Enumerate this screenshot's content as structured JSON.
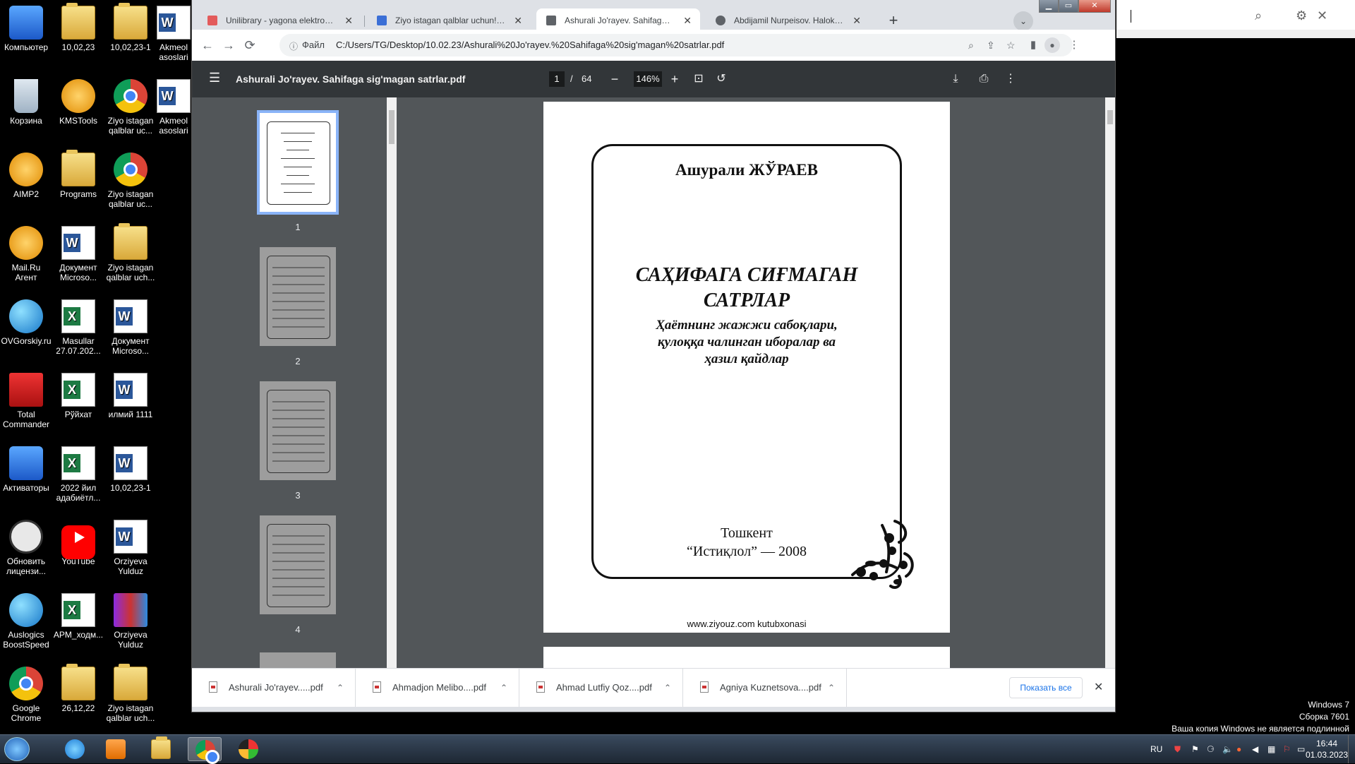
{
  "desktop": {
    "icons": [
      {
        "label": "Компьютер",
        "kind": "blue"
      },
      {
        "label": "10,02,23",
        "kind": "folder"
      },
      {
        "label": "10,02,23-1",
        "kind": "folder"
      },
      {
        "label": "Akmeol asoslari",
        "kind": "word"
      },
      {
        "label": "Корзина",
        "kind": "bin"
      },
      {
        "label": "KMSTools",
        "kind": "orange"
      },
      {
        "label": "Ziyo istagan qalblar uc...",
        "kind": "chrome"
      },
      {
        "label": "Akmeol asoslari",
        "kind": "word"
      },
      {
        "label": "AIMP2",
        "kind": "orange"
      },
      {
        "label": "Programs",
        "kind": "folder"
      },
      {
        "label": "Ziyo istagan qalblar uc...",
        "kind": "chrome"
      },
      {
        "label": "Mail.Ru Агент",
        "kind": "orange"
      },
      {
        "label": "Документ Microso...",
        "kind": "word"
      },
      {
        "label": "Ziyo istagan qalblar uch...",
        "kind": "folder"
      },
      {
        "label": "OVGorskiy.ru",
        "kind": "globe"
      },
      {
        "label": "Masullar 27.07.202...",
        "kind": "excel"
      },
      {
        "label": "Документ Microso...",
        "kind": "word"
      },
      {
        "label": "Total Commander",
        "kind": "disk"
      },
      {
        "label": "Рўйхат",
        "kind": "excel"
      },
      {
        "label": "илмий 1111",
        "kind": "word"
      },
      {
        "label": "Активаторы",
        "kind": "blue"
      },
      {
        "label": "2022 йил адабиётл...",
        "kind": "excel"
      },
      {
        "label": "10,02,23-1",
        "kind": "word"
      },
      {
        "label": "Обновить лицензи...",
        "kind": "skull"
      },
      {
        "label": "YouTube",
        "kind": "yt"
      },
      {
        "label": "Orziyeva Yulduz",
        "kind": "word"
      },
      {
        "label": "Auslogics BoostSpeed",
        "kind": "globe"
      },
      {
        "label": "APM_ходм...",
        "kind": "excel"
      },
      {
        "label": "Orziyeva Yulduz",
        "kind": "rar"
      },
      {
        "label": "Google Chrome",
        "kind": "chrome"
      },
      {
        "label": "26,12,22",
        "kind": "folder"
      },
      {
        "label": "Ziyo istagan qalblar uch...",
        "kind": "folder"
      }
    ]
  },
  "browser": {
    "tabs": [
      {
        "title": "Unilibrary - yagona elektron kutub",
        "favicon_color": "#e35b5b",
        "active": false
      },
      {
        "title": "Ziyo istagan qalblar uchun! - Kutub",
        "favicon_color": "#3b6fd6",
        "active": false
      },
      {
        "title": "Ashurali Jo'rayev. Sahifaga sig'mag",
        "favicon_color": "#5f6368",
        "active": true
      },
      {
        "title": "Abdijamil Nurpeisov. Halokat (trilo",
        "favicon_color": "#5f6368",
        "active": false
      }
    ],
    "new_tab_symbol": "+",
    "tab_search_symbol": "⌄",
    "address": {
      "scheme_label": "Файл",
      "url": "C:/Users/TG/Desktop/10.02.23/Ashurali%20Jo'rayev.%20Sahifaga%20sig'magan%20satrlar.pdf"
    }
  },
  "pdf": {
    "title": "Ashurali Jo'rayev. Sahifaga sig'magan satrlar.pdf",
    "current_page": "1",
    "page_separator": "/",
    "total_pages": "64",
    "zoom": "146%",
    "thumbnails": [
      "1",
      "2",
      "3",
      "4"
    ],
    "page1": {
      "author": "Ашурали ЖЎРАЕВ",
      "title_line1": "САҲИФАГА  СИҒМАГАН",
      "title_line2": "САТРЛАР",
      "subtitle_line1": "Ҳаётнинг жажжи сабоқлари,",
      "subtitle_line2": "қулоққа чалинган иборалар ва",
      "subtitle_line3": "ҳазил қайдлар",
      "city": "Тошкент",
      "publisher": "“Истиқлол” — 2008",
      "footer": "www.ziyouz.com kutubxonasi"
    }
  },
  "downloads": {
    "items": [
      "Ashurali Jo'rayev.....pdf",
      "Ahmadjon Melibo....pdf",
      "Ahmad Lutfiy Qoz....pdf",
      "Agniya Kuznetsova....pdf"
    ],
    "show_all": "Показать все"
  },
  "taskbar": {
    "lang": "RU",
    "time": "16:44",
    "date": "01.03.2023"
  },
  "watermark": {
    "line1": "Windows 7",
    "line2": "Сборка 7601",
    "line3": "Ваша копия Windows не является подлинной"
  }
}
